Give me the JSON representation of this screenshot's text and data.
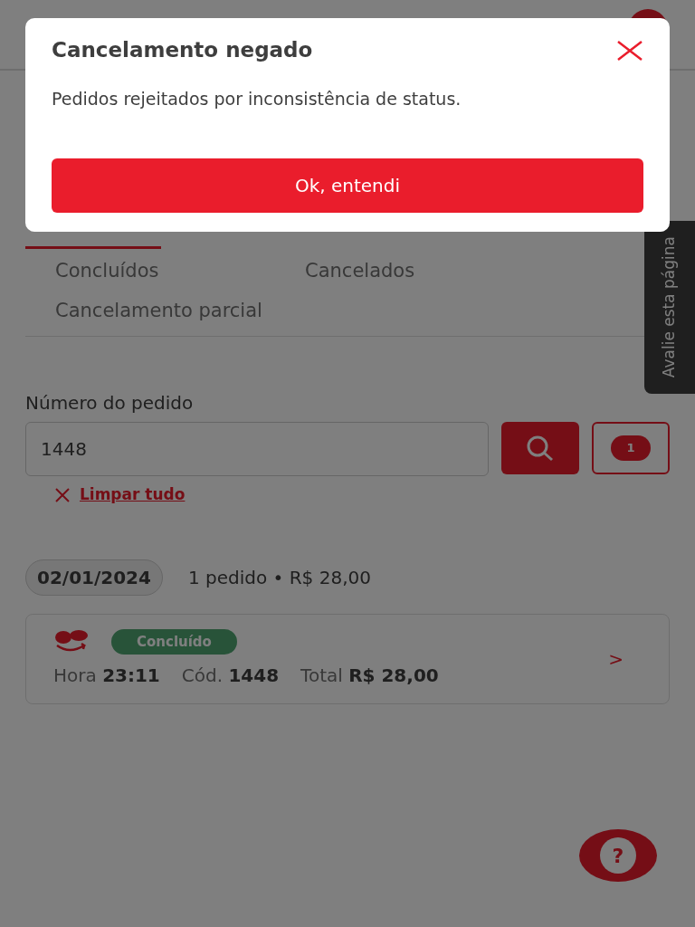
{
  "tabs": [
    {
      "label": "Concluídos",
      "selected": false
    },
    {
      "label": "Cancelados",
      "selected": false
    },
    {
      "label": "Cancelamento parcial",
      "selected": false
    }
  ],
  "search": {
    "label": "Número do pedido",
    "value": "1448",
    "filter_count": "1",
    "clear_label": "Limpar tudo"
  },
  "group": {
    "date": "02/01/2024",
    "summary": "1 pedido • R$ 28,00"
  },
  "orders": [
    {
      "status": "Concluído",
      "time_label": "Hora",
      "time": "23:11",
      "code_label": "Cód.",
      "code": "1448",
      "total_label": "Total",
      "total": "R$ 28,00",
      "chevron": ">"
    }
  ],
  "feedback_tab": "Avalie esta página",
  "help_button": "?",
  "dialog": {
    "title": "Cancelamento negado",
    "message": "Pedidos rejeitados por inconsistência de status.",
    "button": "Ok, entendi"
  }
}
